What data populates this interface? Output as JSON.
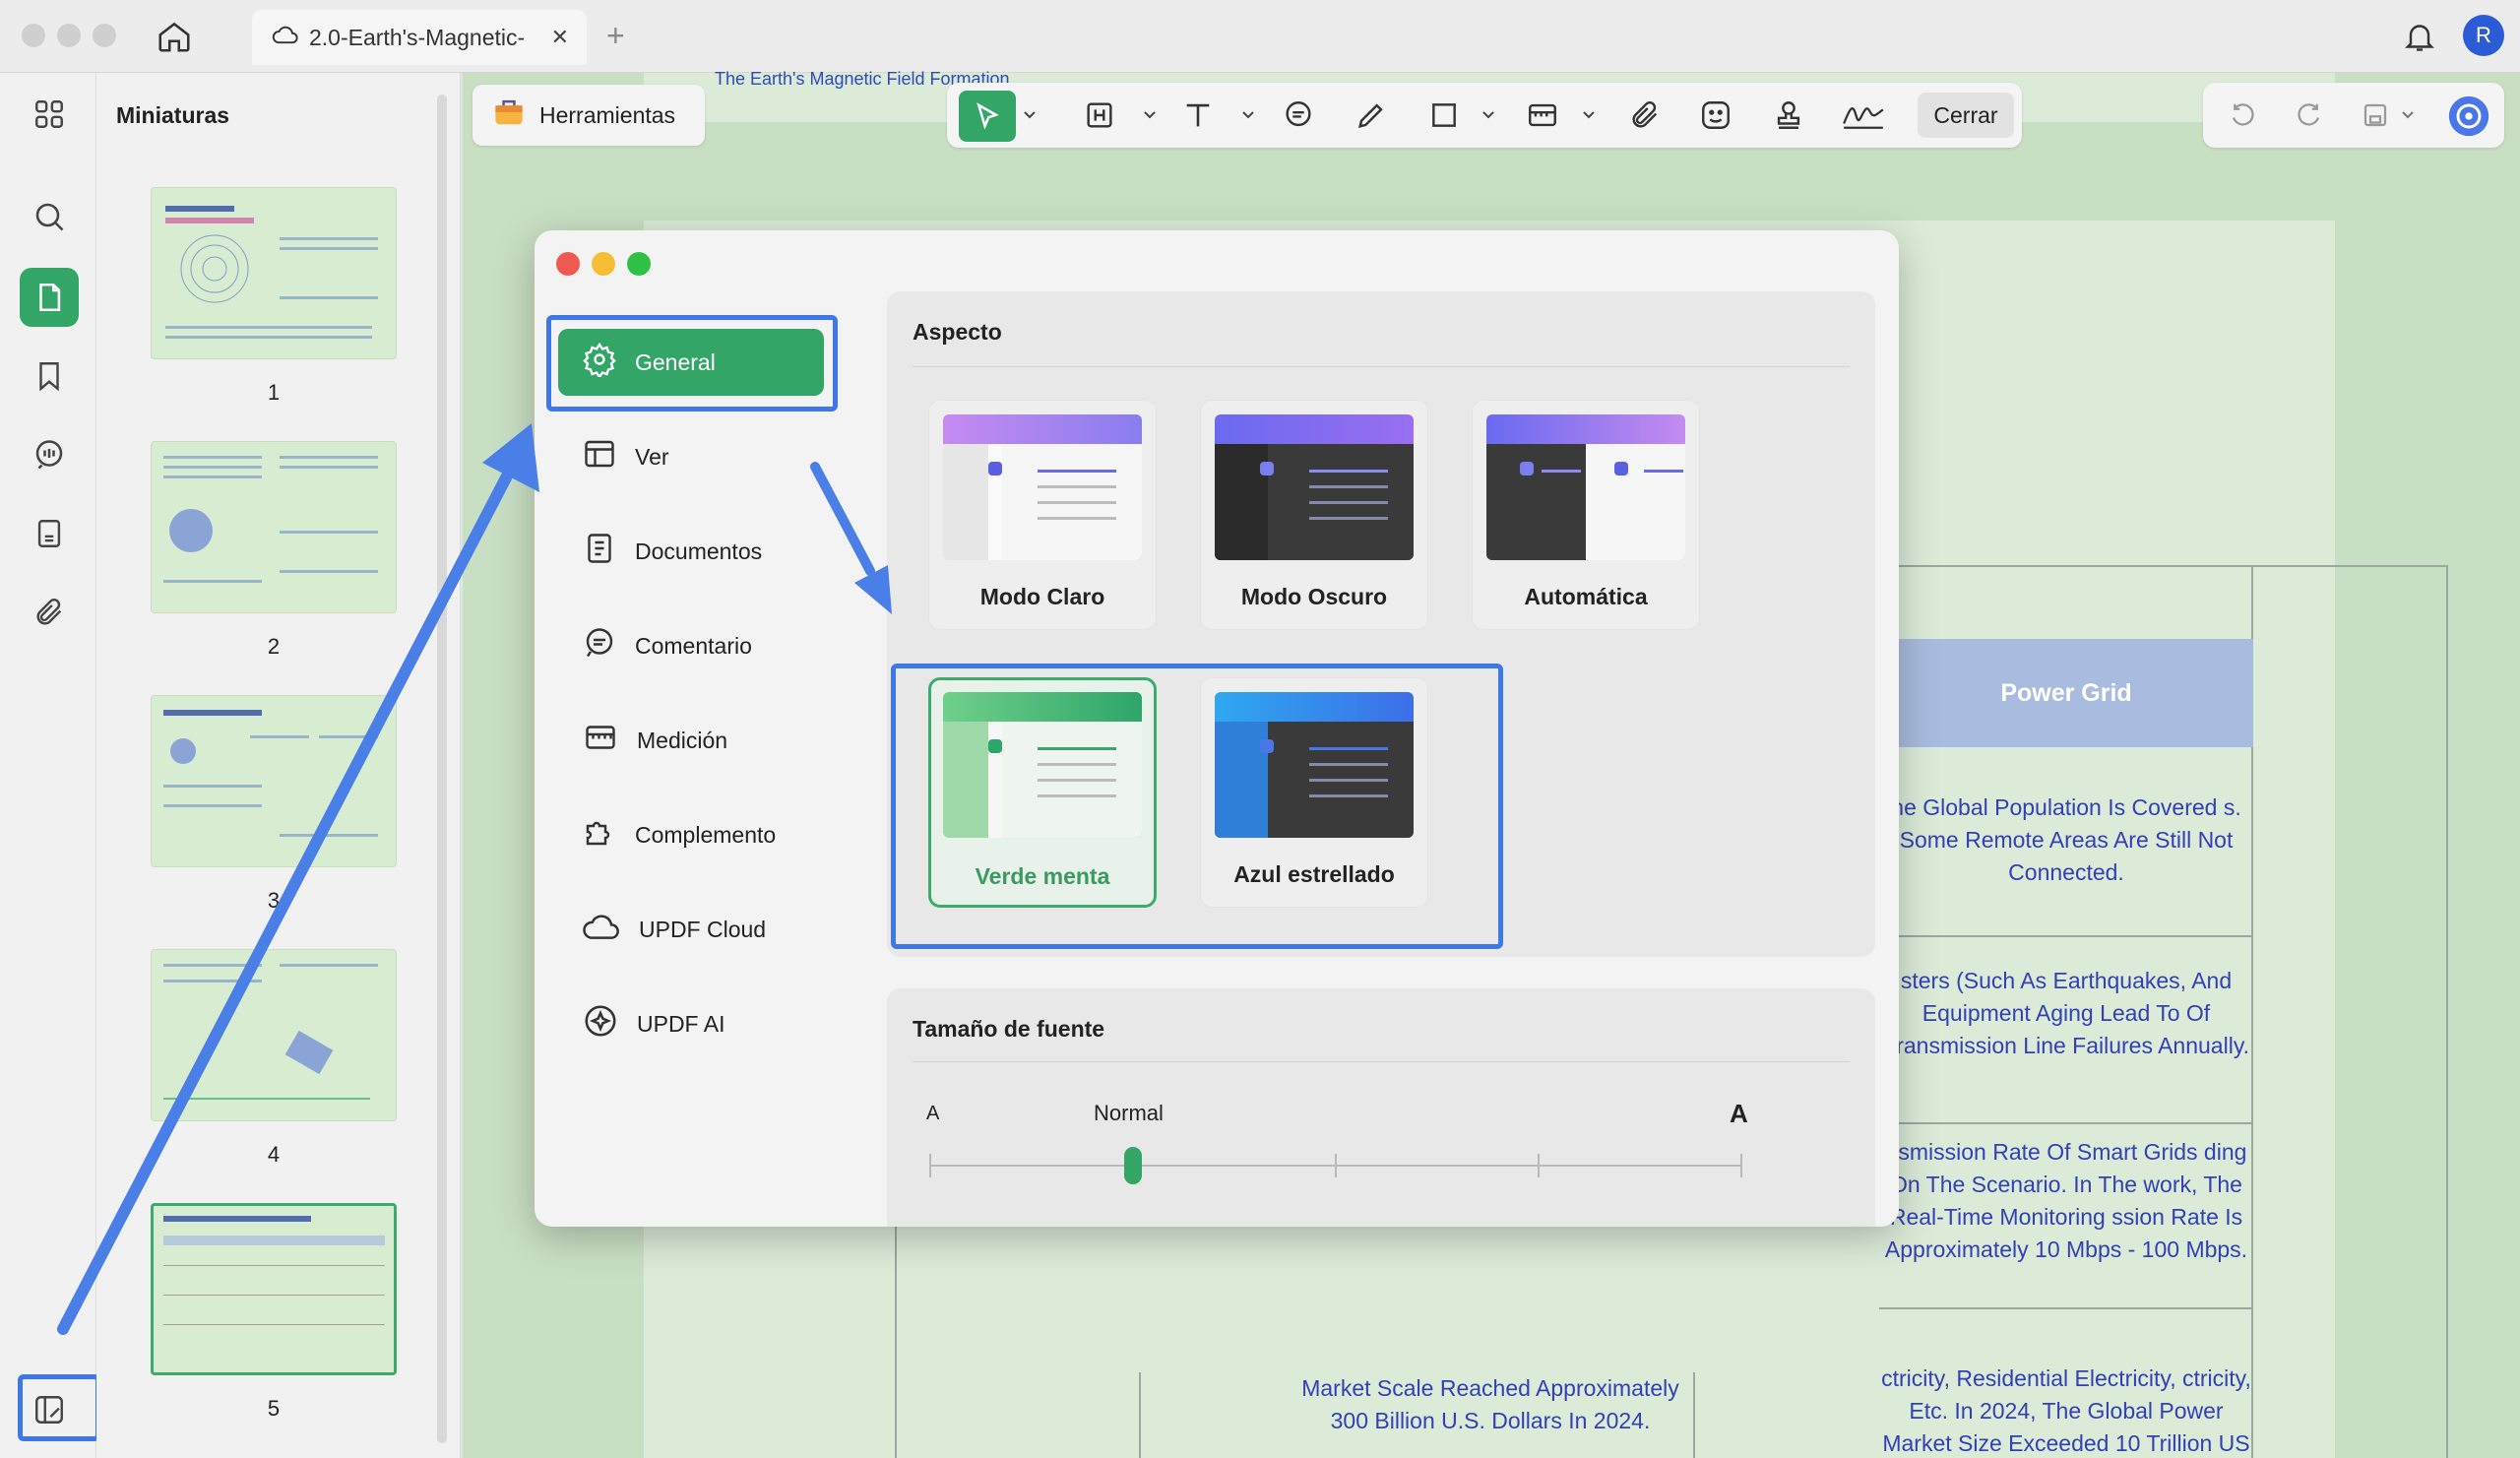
{
  "window": {
    "tab_title": "2.0-Earth's-Magnetic-",
    "avatar_letter": "R"
  },
  "thumbnails": {
    "title": "Miniaturas",
    "pages": [
      "1",
      "2",
      "3",
      "4",
      "5"
    ],
    "selected_page": "5"
  },
  "toolbar": {
    "tools_label": "Herramientas",
    "close_label": "Cerrar"
  },
  "document": {
    "header_text": "The Earth's Magnetic Field Formation",
    "table": {
      "column_header": "Power Grid",
      "cells": [
        "he Global Population Is Covered s. Some Remote Areas Are Still Not Connected.",
        "sters (Such As Earthquakes, And Equipment Aging Lead To Of Transmission Line Failures Annually.",
        "nsmission Rate Of Smart Grids ding On The Scenario. In The work, The Real-Time Monitoring ssion Rate Is Approximately 10 Mbps - 100 Mbps.",
        "ctricity, Residential Electricity, ctricity, Etc. In 2024, The Global Power Market Size Exceeded 10 Trillion US Dollars."
      ],
      "middle_bottom_cell": "Market Scale Reached Approximately 300 Billion U.S. Dollars In 2024."
    }
  },
  "settings": {
    "nav": [
      {
        "label": "General",
        "icon": "gear-icon"
      },
      {
        "label": "Ver",
        "icon": "view-icon"
      },
      {
        "label": "Documentos",
        "icon": "document-icon"
      },
      {
        "label": "Comentario",
        "icon": "comment-icon"
      },
      {
        "label": "Medición",
        "icon": "ruler-icon"
      },
      {
        "label": "Complemento",
        "icon": "puzzle-icon"
      },
      {
        "label": "UPDF Cloud",
        "icon": "cloud-icon"
      },
      {
        "label": "UPDF AI",
        "icon": "ai-icon"
      }
    ],
    "active_nav": "General",
    "appearance": {
      "title": "Aspecto",
      "themes": [
        {
          "label": "Modo Claro"
        },
        {
          "label": "Modo Oscuro"
        },
        {
          "label": "Automática"
        },
        {
          "label": "Verde menta"
        },
        {
          "label": "Azul estrellado"
        }
      ],
      "selected_theme": "Verde menta"
    },
    "font_size": {
      "title": "Tamaño de fuente",
      "small_label": "A",
      "large_label": "A",
      "current_label": "Normal",
      "levels": 5,
      "current_level_index": 1
    }
  },
  "colors": {
    "accent_green": "#33a566",
    "highlight_blue": "#3e78e8",
    "doc_text_blue": "#3340b5"
  }
}
